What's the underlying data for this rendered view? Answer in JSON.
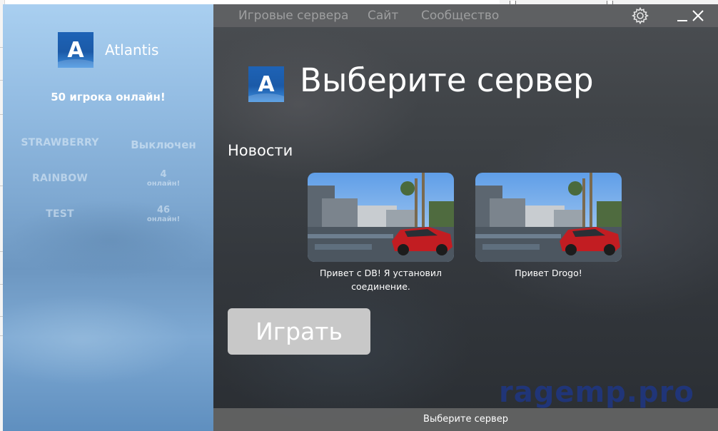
{
  "app": {
    "brand_name": "Atlantis",
    "logo_letter": "A"
  },
  "sidebar": {
    "online_total": "50 игрока онлайн!",
    "servers": [
      {
        "name": "STRAWBERRY",
        "status": "Выключен"
      },
      {
        "name": "RAINBOW",
        "count": "4",
        "count_label": "онлайн!"
      },
      {
        "name": "TEST",
        "count": "46",
        "count_label": "онлайн!"
      }
    ]
  },
  "nav": {
    "items": [
      {
        "label": "Игровые сервера"
      },
      {
        "label": "Сайт"
      },
      {
        "label": "Сообщество"
      }
    ]
  },
  "main": {
    "title": "Выберите сервер",
    "news_heading": "Новости",
    "news": [
      {
        "caption": "Привет с DB! Я установил соединение."
      },
      {
        "caption": "Привет Drogo!"
      }
    ],
    "play_label": "Играть",
    "watermark": "ragemp.pro"
  },
  "status_bar": {
    "text": "Выберите сервер"
  },
  "colors": {
    "sidebar_blue": "#94bde3",
    "logo_blue": "#1e63b6",
    "play_button": "#c8c8c8",
    "watermark": "#1e378c"
  },
  "icons": [
    "gear-icon",
    "minimize-icon",
    "close-icon"
  ]
}
